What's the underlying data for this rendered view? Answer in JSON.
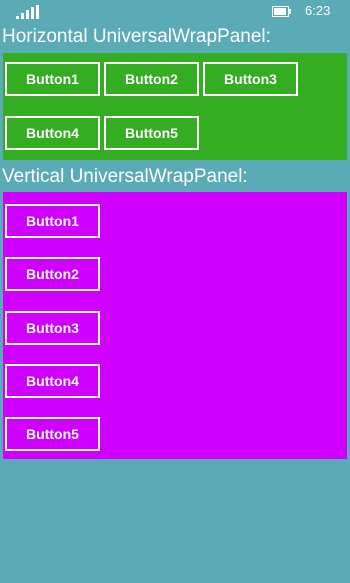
{
  "status_bar": {
    "time": "6:23",
    "icons": [
      "signal-icon",
      "battery-icon"
    ]
  },
  "horizontal_panel": {
    "title": "Horizontal UniversalWrapPanel:",
    "background": "#34ad23",
    "buttons": [
      "Button1",
      "Button2",
      "Button3",
      "Button4",
      "Button5"
    ]
  },
  "vertical_panel": {
    "title": "Vertical UniversalWrapPanel:",
    "background": "#cf00ff",
    "buttons": [
      "Button1",
      "Button2",
      "Button3",
      "Button4",
      "Button5"
    ]
  },
  "colors": {
    "page_background": "#5aabb5",
    "text": "#ffffff",
    "button_border": "#ffffff"
  }
}
